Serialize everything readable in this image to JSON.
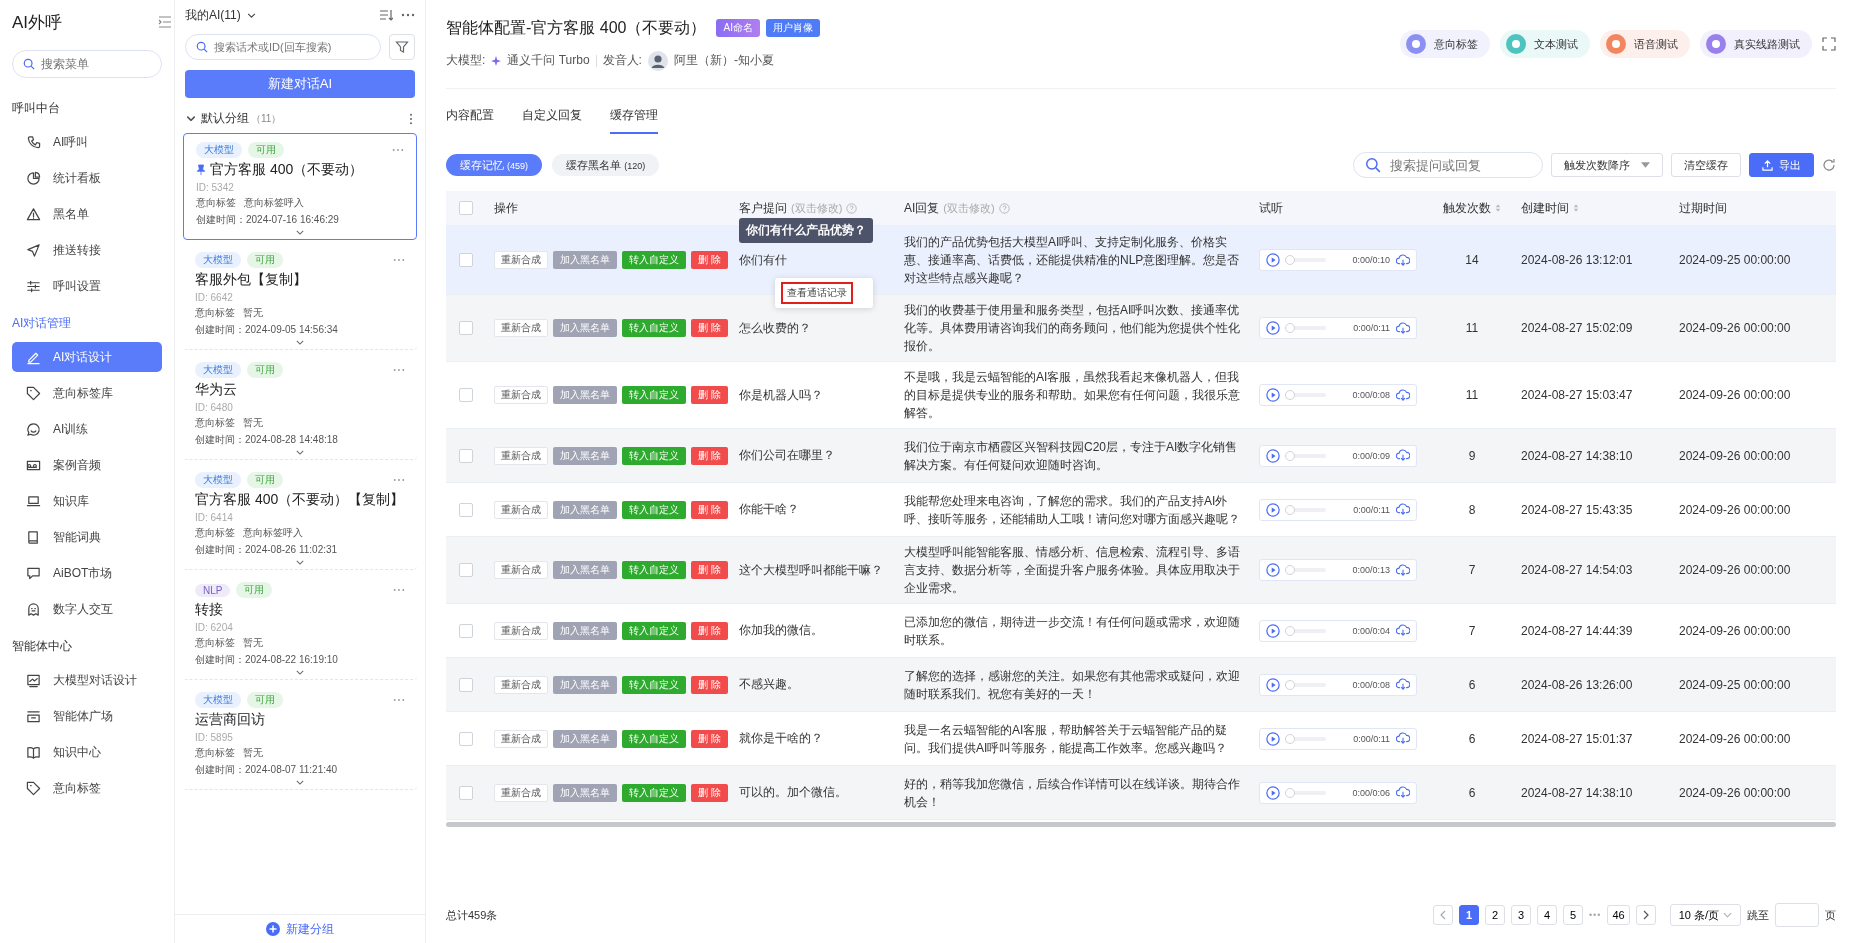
{
  "sidebar": {
    "title": "AI外呼",
    "search": {
      "placeholder": "搜索菜单"
    },
    "groups": [
      {
        "heading": "呼叫中台",
        "active": false,
        "items": [
          {
            "label": "AI呼叫",
            "selected": false
          },
          {
            "label": "统计看板",
            "selected": false
          },
          {
            "label": "黑名单",
            "selected": false
          },
          {
            "label": "推送转接",
            "selected": false
          },
          {
            "label": "呼叫设置",
            "selected": false
          }
        ]
      },
      {
        "heading": "AI对话管理",
        "active": true,
        "items": [
          {
            "label": "AI对话设计",
            "selected": true
          },
          {
            "label": "意向标签库",
            "selected": false
          },
          {
            "label": "AI训练",
            "selected": false
          },
          {
            "label": "案例音频",
            "selected": false
          },
          {
            "label": "知识库",
            "selected": false
          },
          {
            "label": "智能词典",
            "selected": false
          },
          {
            "label": "AiBOT市场",
            "selected": false
          },
          {
            "label": "数字人交互",
            "selected": false
          }
        ]
      },
      {
        "heading": "智能体中心",
        "active": false,
        "items": [
          {
            "label": "大模型对话设计",
            "selected": false
          },
          {
            "label": "智能体广场",
            "selected": false
          },
          {
            "label": "知识中心",
            "selected": false
          },
          {
            "label": "意向标签",
            "selected": false
          }
        ]
      }
    ]
  },
  "ai_list": {
    "title": "我的AI(11)",
    "search": {
      "placeholder": "搜索话术或ID(回车搜索)"
    },
    "new_button": "新建对话AI",
    "group": {
      "name": "默认分组",
      "count": "（11）",
      "expanded": true
    },
    "cards": [
      {
        "tags": [
          {
            "label": "大模型",
            "kind": "model"
          },
          {
            "label": "可用",
            "kind": "status"
          }
        ],
        "pinned": true,
        "name": "官方客服 400（不要动）",
        "id": "ID: 5342",
        "intent_label": "意向标签",
        "intent": "意向标签呼入",
        "created": "创建时间：2024-07-16 16:46:29",
        "selected": true
      },
      {
        "tags": [
          {
            "label": "大模型",
            "kind": "model"
          },
          {
            "label": "可用",
            "kind": "status"
          }
        ],
        "pinned": false,
        "name": "客服外包【复制】",
        "id": "ID: 6642",
        "intent_label": "意向标签",
        "intent": "暂无",
        "created": "创建时间：2024-09-05 14:56:34",
        "selected": false
      },
      {
        "tags": [
          {
            "label": "大模型",
            "kind": "model"
          },
          {
            "label": "可用",
            "kind": "status"
          }
        ],
        "pinned": false,
        "name": "华为云",
        "id": "ID: 6480",
        "intent_label": "意向标签",
        "intent": "暂无",
        "created": "创建时间：2024-08-28 14:48:18",
        "selected": false
      },
      {
        "tags": [
          {
            "label": "大模型",
            "kind": "model"
          },
          {
            "label": "可用",
            "kind": "status"
          }
        ],
        "pinned": false,
        "name": "官方客服 400（不要动）【复制】",
        "id": "ID: 6414",
        "intent_label": "意向标签",
        "intent": "意向标签呼入",
        "created": "创建时间：2024-08-26 11:02:31",
        "selected": false
      },
      {
        "tags": [
          {
            "label": "NLP",
            "kind": "nlp"
          },
          {
            "label": "可用",
            "kind": "status"
          }
        ],
        "pinned": false,
        "name": "转接",
        "id": "ID: 6204",
        "intent_label": "意向标签",
        "intent": "暂无",
        "created": "创建时间：2024-08-22 16:19:10",
        "selected": false
      },
      {
        "tags": [
          {
            "label": "大模型",
            "kind": "model"
          },
          {
            "label": "可用",
            "kind": "status"
          }
        ],
        "pinned": false,
        "name": "运营商回访",
        "id": "ID: 5895",
        "intent_label": "意向标签",
        "intent": "暂无",
        "created": "创建时间：2024-08-07 11:21:40",
        "selected": false
      }
    ],
    "footer_button": "新建分组"
  },
  "header": {
    "title": "智能体配置-官方客服 400（不要动）",
    "badges": [
      {
        "label": "AI命名",
        "kind": "ai"
      },
      {
        "label": "用户肖像",
        "kind": "user"
      }
    ],
    "model_label": "大模型:",
    "model": "通义千问 Turbo",
    "voice_label": "发音人:",
    "voice": "阿里（新）-知小夏",
    "tools": [
      {
        "label": "意向标签",
        "color": "#8b90f2"
      },
      {
        "label": "文本测试",
        "color": "#4fc4bf"
      },
      {
        "label": "语音测试",
        "color": "#f2865f"
      },
      {
        "label": "真实线路测试",
        "color": "#9a80ee"
      }
    ]
  },
  "tabs": [
    {
      "label": "内容配置",
      "selected": false
    },
    {
      "label": "自定义回复",
      "selected": false
    },
    {
      "label": "缓存管理",
      "selected": true
    }
  ],
  "subtabs": [
    {
      "label": "缓存记忆",
      "count": "(459)",
      "selected": true
    },
    {
      "label": "缓存黑名单",
      "count": "(120)",
      "selected": false
    }
  ],
  "toolbar": {
    "search": {
      "placeholder": "搜索提问或回复"
    },
    "sort": "触发次数降序",
    "clear": "清空缓存",
    "export": "导出"
  },
  "table": {
    "header_checked": false,
    "columns": [
      {
        "label": "操作"
      },
      {
        "label": "客户提问",
        "hint": "(双击修改)",
        "help": true
      },
      {
        "label": "AI回复",
        "hint": "(双击修改)",
        "help": true
      },
      {
        "label": "试听"
      },
      {
        "label": "触发次数",
        "sortable": true
      },
      {
        "label": "创建时间",
        "sortable": true
      },
      {
        "label": "过期时间"
      }
    ],
    "rows": [
      {
        "selected": true,
        "checked": false,
        "actions": [
          {
            "label": "重新合成",
            "kind": "resynth"
          },
          {
            "label": "加入黑名单",
            "kind": "blacklist"
          },
          {
            "label": "转入自定义",
            "kind": "custom"
          },
          {
            "label": "删 除",
            "kind": "delete"
          }
        ],
        "question": "你们有什",
        "answer": "我们的产品优势包括大模型AI呼叫、支持定制化服务、价格实惠、接通率高、话费低，还能提供精准的NLP意图理解。您是否对这些特点感兴趣呢？",
        "audio": {
          "time": "0:00/0:10",
          "level": 0
        },
        "count": "14",
        "created": "2024-08-26 13:12:01",
        "expires": "2024-09-25 00:00:00"
      },
      {
        "selected": false,
        "checked": false,
        "actions": [
          {
            "label": "重新合成",
            "kind": "resynth"
          },
          {
            "label": "加入黑名单",
            "kind": "blacklist"
          },
          {
            "label": "转入自定义",
            "kind": "custom"
          },
          {
            "label": "删 除",
            "kind": "delete"
          }
        ],
        "question": "怎么收费的？",
        "answer": "我们的收费基于使用量和服务类型，包括AI呼叫次数、接通率优化等。具体费用请咨询我们的商务顾问，他们能为您提供个性化报价。",
        "audio": {
          "time": "0:00/0:11",
          "level": 0
        },
        "count": "11",
        "created": "2024-08-27 15:02:09",
        "expires": "2024-09-26 00:00:00"
      },
      {
        "selected": false,
        "checked": false,
        "actions": [
          {
            "label": "重新合成",
            "kind": "resynth"
          },
          {
            "label": "加入黑名单",
            "kind": "blacklist"
          },
          {
            "label": "转入自定义",
            "kind": "custom"
          },
          {
            "label": "删 除",
            "kind": "delete"
          }
        ],
        "question": "你是机器人吗？",
        "answer": "不是哦，我是云蝠智能的AI客服，虽然我看起来像机器人，但我的目标是提供专业的服务和帮助。如果您有任何问题，我很乐意解答。",
        "audio": {
          "time": "0:00/0:08",
          "level": 0
        },
        "count": "11",
        "created": "2024-08-27 15:03:47",
        "expires": "2024-09-26 00:00:00"
      },
      {
        "selected": false,
        "checked": false,
        "actions": [
          {
            "label": "重新合成",
            "kind": "resynth"
          },
          {
            "label": "加入黑名单",
            "kind": "blacklist"
          },
          {
            "label": "转入自定义",
            "kind": "custom"
          },
          {
            "label": "删 除",
            "kind": "delete"
          }
        ],
        "question": "你们公司在哪里？",
        "answer": "我们位于南京市栖霞区兴智科技园C20层，专注于AI数字化销售解决方案。有任何疑问欢迎随时咨询。",
        "audio": {
          "time": "0:00/0:09",
          "level": 0
        },
        "count": "9",
        "created": "2024-08-27 14:38:10",
        "expires": "2024-09-26 00:00:00"
      },
      {
        "selected": false,
        "checked": false,
        "actions": [
          {
            "label": "重新合成",
            "kind": "resynth"
          },
          {
            "label": "加入黑名单",
            "kind": "blacklist"
          },
          {
            "label": "转入自定义",
            "kind": "custom"
          },
          {
            "label": "删 除",
            "kind": "delete"
          }
        ],
        "question": "你能干啥？",
        "answer": "我能帮您处理来电咨询，了解您的需求。我们的产品支持AI外呼、接听等服务，还能辅助人工哦！请问您对哪方面感兴趣呢？",
        "audio": {
          "time": "0:00/0:11",
          "level": 0
        },
        "count": "8",
        "created": "2024-08-27 15:43:35",
        "expires": "2024-09-26 00:00:00"
      },
      {
        "selected": false,
        "checked": false,
        "actions": [
          {
            "label": "重新合成",
            "kind": "resynth"
          },
          {
            "label": "加入黑名单",
            "kind": "blacklist"
          },
          {
            "label": "转入自定义",
            "kind": "custom"
          },
          {
            "label": "删 除",
            "kind": "delete"
          }
        ],
        "question": "这个大模型呼叫都能干嘛？",
        "answer": "大模型呼叫能智能客服、情感分析、信息检索、流程引导、多语言支持、数据分析等，全面提升客户服务体验。具体应用取决于企业需求。",
        "audio": {
          "time": "0:00/0:13",
          "level": 0
        },
        "count": "7",
        "created": "2024-08-27 14:54:03",
        "expires": "2024-09-26 00:00:00"
      },
      {
        "selected": false,
        "checked": false,
        "actions": [
          {
            "label": "重新合成",
            "kind": "resynth"
          },
          {
            "label": "加入黑名单",
            "kind": "blacklist"
          },
          {
            "label": "转入自定义",
            "kind": "custom"
          },
          {
            "label": "删 除",
            "kind": "delete"
          }
        ],
        "question": "你加我的微信。",
        "answer": "已添加您的微信，期待进一步交流！有任何问题或需求，欢迎随时联系。",
        "audio": {
          "time": "0:00/0:04",
          "level": 0
        },
        "count": "7",
        "created": "2024-08-27 14:44:39",
        "expires": "2024-09-26 00:00:00"
      },
      {
        "selected": false,
        "checked": false,
        "actions": [
          {
            "label": "重新合成",
            "kind": "resynth"
          },
          {
            "label": "加入黑名单",
            "kind": "blacklist"
          },
          {
            "label": "转入自定义",
            "kind": "custom"
          },
          {
            "label": "删 除",
            "kind": "delete"
          }
        ],
        "question": "不感兴趣。",
        "answer": "了解您的选择，感谢您的关注。如果您有其他需求或疑问，欢迎随时联系我们。祝您有美好的一天！",
        "audio": {
          "time": "0:00/0:08",
          "level": 0
        },
        "count": "6",
        "created": "2024-08-26 13:26:00",
        "expires": "2024-09-25 00:00:00"
      },
      {
        "selected": false,
        "checked": false,
        "actions": [
          {
            "label": "重新合成",
            "kind": "resynth"
          },
          {
            "label": "加入黑名单",
            "kind": "blacklist"
          },
          {
            "label": "转入自定义",
            "kind": "custom"
          },
          {
            "label": "删 除",
            "kind": "delete"
          }
        ],
        "question": "就你是干啥的？",
        "answer": "我是一名云蝠智能的AI客服，帮助解答关于云蝠智能产品的疑问。我们提供AI呼叫等服务，能提高工作效率。您感兴趣吗？",
        "audio": {
          "time": "0:00/0:11",
          "level": 0
        },
        "count": "6",
        "created": "2024-08-27 15:01:37",
        "expires": "2024-09-26 00:00:00"
      },
      {
        "selected": false,
        "checked": false,
        "actions": [
          {
            "label": "重新合成",
            "kind": "resynth"
          },
          {
            "label": "加入黑名单",
            "kind": "blacklist"
          },
          {
            "label": "转入自定义",
            "kind": "custom"
          },
          {
            "label": "删 除",
            "kind": "delete"
          }
        ],
        "question": "可以的。加个微信。",
        "answer": "好的，稍等我加您微信，后续合作详情可以在线详谈。期待合作机会！",
        "audio": {
          "time": "0:00/0:06",
          "level": 0
        },
        "count": "6",
        "created": "2024-08-27 14:38:10",
        "expires": "2024-09-26 00:00:00"
      }
    ],
    "tooltip": "你们有什么产品优势？",
    "popup": "查看通话记录"
  },
  "pagination": {
    "total": "总计459条",
    "pages": [
      {
        "label": "1",
        "selected": true
      },
      {
        "label": "2",
        "selected": false
      },
      {
        "label": "3",
        "selected": false
      },
      {
        "label": "4",
        "selected": false
      },
      {
        "label": "5",
        "selected": false
      },
      {
        "label": "•••",
        "kind": "ellipsis"
      },
      {
        "label": "46",
        "selected": false
      }
    ],
    "page_size": "10 条/页",
    "jump_label": "跳至",
    "jump_unit": "页"
  }
}
